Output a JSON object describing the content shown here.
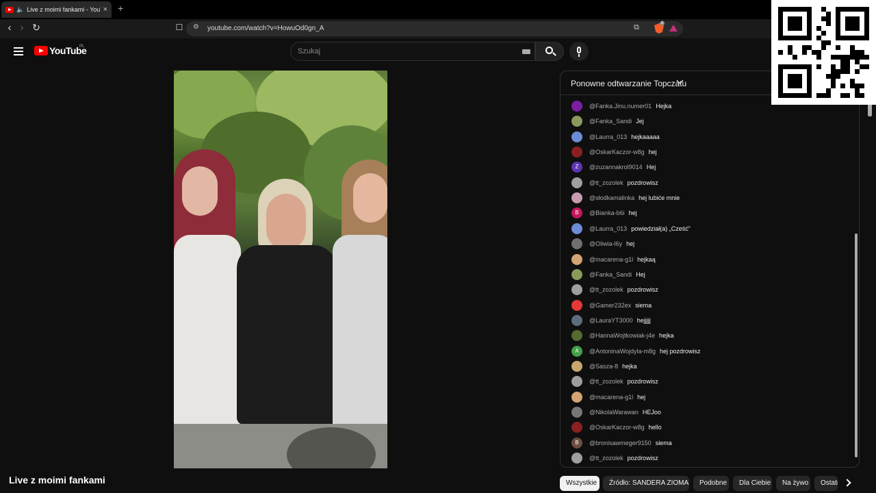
{
  "browser": {
    "tab_title": "Live z moimi fankami - YouTu",
    "new_tab": "+",
    "url": "youtube.com/watch?v=HowuOd0gn_A",
    "brave_badge": "2"
  },
  "header": {
    "logo_text": "YouTube",
    "logo_country": "PL",
    "search_placeholder": "Szukaj"
  },
  "video": {
    "title": "Live z moimi fankami"
  },
  "chat": {
    "header_title": "Ponowne odtwarzanie Topczatu",
    "messages": [
      {
        "author": "@Fanka.Jinu.numer01",
        "text": "Hejka",
        "avatar_color": "#7a1fa2",
        "initial": ""
      },
      {
        "author": "@Fanka_Sandi",
        "text": "Jej",
        "avatar_color": "#8a9a5b",
        "initial": ""
      },
      {
        "author": "@Laurra_013",
        "text": "hejkaaaaa",
        "avatar_color": "#6c8cd5",
        "initial": ""
      },
      {
        "author": "@OskarKaczor-w8g",
        "text": "hej",
        "avatar_color": "#8b2020",
        "initial": ""
      },
      {
        "author": "@zuzannakrol9014",
        "text": "Hej",
        "avatar_color": "#5e35b1",
        "initial": "Z"
      },
      {
        "author": "@tt_zozolek",
        "text": "pozdrowisz",
        "avatar_color": "#9e9e9e",
        "initial": ""
      },
      {
        "author": "@słodkamalinka",
        "text": "hej lubiće mnie",
        "avatar_color": "#c79ab0",
        "initial": ""
      },
      {
        "author": "@Bianka-b6i",
        "text": "hej",
        "avatar_color": "#c2185b",
        "initial": "B"
      },
      {
        "author": "@Laurra_013",
        "text": "powiedział(a) „Cześć”",
        "avatar_color": "#6c8cd5",
        "initial": ""
      },
      {
        "author": "@Oliwia-l6y",
        "text": "hej",
        "avatar_color": "#707070",
        "initial": ""
      },
      {
        "author": "@macarena-g1l",
        "text": "hejkaą",
        "avatar_color": "#d4a373",
        "initial": ""
      },
      {
        "author": "@Fanka_Sandi",
        "text": "Hej",
        "avatar_color": "#8a9a5b",
        "initial": ""
      },
      {
        "author": "@tt_zozolek",
        "text": "pozdrowisz",
        "avatar_color": "#9e9e9e",
        "initial": ""
      },
      {
        "author": "@Gamer232ex",
        "text": "siema",
        "avatar_color": "#e53935",
        "initial": ""
      },
      {
        "author": "@LauraYT3000",
        "text": "hejjjjj",
        "avatar_color": "#5d6d7e",
        "initial": ""
      },
      {
        "author": "@HannaWojtkowiak-j4e",
        "text": "hejka",
        "avatar_color": "#556b2f",
        "initial": ""
      },
      {
        "author": "@AntoninaWojdyla-m8g",
        "text": "hej pozdrowisz",
        "avatar_color": "#43a047",
        "initial": "A"
      },
      {
        "author": "@Sasza-8",
        "text": "hejka",
        "avatar_color": "#c9a66b",
        "initial": ""
      },
      {
        "author": "@tt_zozolek",
        "text": "pozdrowisz",
        "avatar_color": "#9e9e9e",
        "initial": ""
      },
      {
        "author": "@macarena-g1l",
        "text": "hej",
        "avatar_color": "#d4a373",
        "initial": ""
      },
      {
        "author": "@NikolaWarawan",
        "text": "HEJoo",
        "avatar_color": "#777777",
        "initial": ""
      },
      {
        "author": "@OskarKaczor-w8g",
        "text": "hello",
        "avatar_color": "#8b2020",
        "initial": ""
      },
      {
        "author": "@bronisawmeger9150",
        "text": "siema",
        "avatar_color": "#6d4c41",
        "initial": "B"
      },
      {
        "author": "@tt_zozolek",
        "text": "pozdrowisz",
        "avatar_color": "#9e9e9e",
        "initial": ""
      }
    ]
  },
  "chips": [
    {
      "label": "Wszystkie",
      "active": true
    },
    {
      "label": "Źródło: SANDERA ZIOMAL",
      "active": false
    },
    {
      "label": "Podobne",
      "active": false
    },
    {
      "label": "Dla Ciebie",
      "active": false
    },
    {
      "label": "Na żywo",
      "active": false
    },
    {
      "label": "Ostatnio przesłane",
      "active": false
    }
  ],
  "icons": {
    "back": "‹",
    "forward": "›",
    "reload": "↻",
    "bookmark": "☐",
    "share": "⧉",
    "tune": "⚙",
    "speaker": "🔈",
    "close": "×"
  },
  "colors": {
    "youtube_red": "#ff0000",
    "background": "#0f0f0f",
    "chip_active": "#f1f1f1"
  }
}
